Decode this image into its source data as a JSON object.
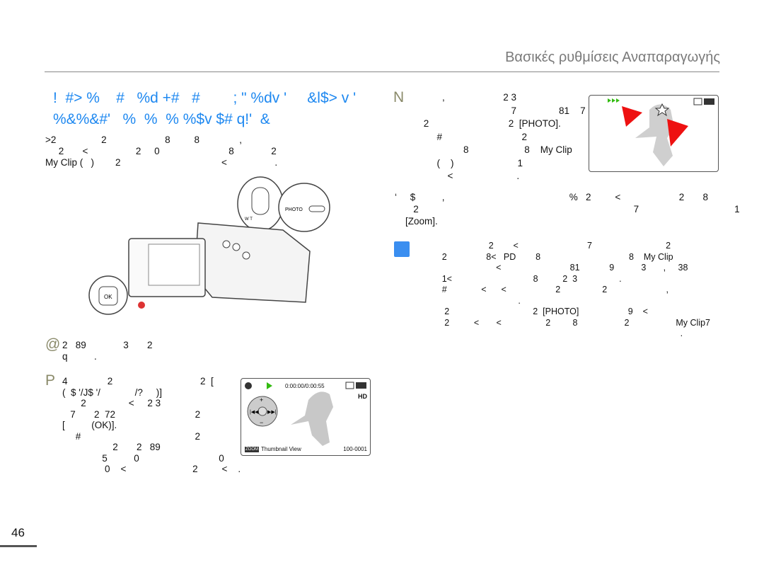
{
  "header": {
    "section_title": "Βασικές ρυθμίσεις Αναπαραγωγής",
    "page_number": "46"
  },
  "left": {
    "title_lines": [
      "!  #> %    #   %d +#   #        ; \" %dv '     &l$> v '",
      "%&%&#'   %  %  % %$v $# q!'  &"
    ],
    "intro_lines": [
      ">2                 2                      8         8               ,",
      "     2       <                  2     0                          8              2",
      "My Clip (   )        2                                      <                  ."
    ],
    "step1_marker": "@",
    "step1_lines": [
      "2   89              3       2",
      "q          ."
    ],
    "step2_marker": "P",
    "step2_lines": [
      "4               2                                 2  [",
      "(  $ '/J$ '/             /?     )]",
      "       2                <     2 3",
      "   7       2  72                              2",
      "[          (OK)].",
      "     #                                           2",
      "                   2       2   89",
      "               5          0                              0",
      "                0    <                         2         <    ."
    ],
    "screen": {
      "time": "0:00:00/0:00:55",
      "quality": "HD",
      "zoom_badge": "ZOOM",
      "zoom_label": "Thumbnail View",
      "file_number": "100-0001"
    }
  },
  "right": {
    "step3_marker": "N",
    "step3_lines": [
      "            ,                      2 3",
      "                                      7                81    7",
      "     2                              2  [PHOTO].",
      "          #                              2",
      "                    8                     8    My Clip",
      "          (    )                        1",
      "              <                        ."
    ],
    "bullet_lines": [
      "‘     $          ,                                               %   2         <                      2       8",
      "       2                                                                                 7                                    1",
      "    [Zoom]."
    ],
    "note_lines": [
      "                             2        <                            7                              2",
      "          2                8<   PD        8                                    8    My Clip",
      "                                <                            81            9           3       ,     38",
      "          1<                                 8          2  3                 .",
      "          #              <      <                    2                 2                        ,",
      "                                         .",
      "           2                                  2  [PHOTO]                    9    <",
      "           2          <       <                  2         8                   2                   My Clip7",
      "                                                                                                           ."
    ]
  },
  "colors": {
    "title": "#1e88f0",
    "note_icon": "#3a8ef0",
    "arrow": "#ee1111",
    "play": "#33bb11"
  }
}
